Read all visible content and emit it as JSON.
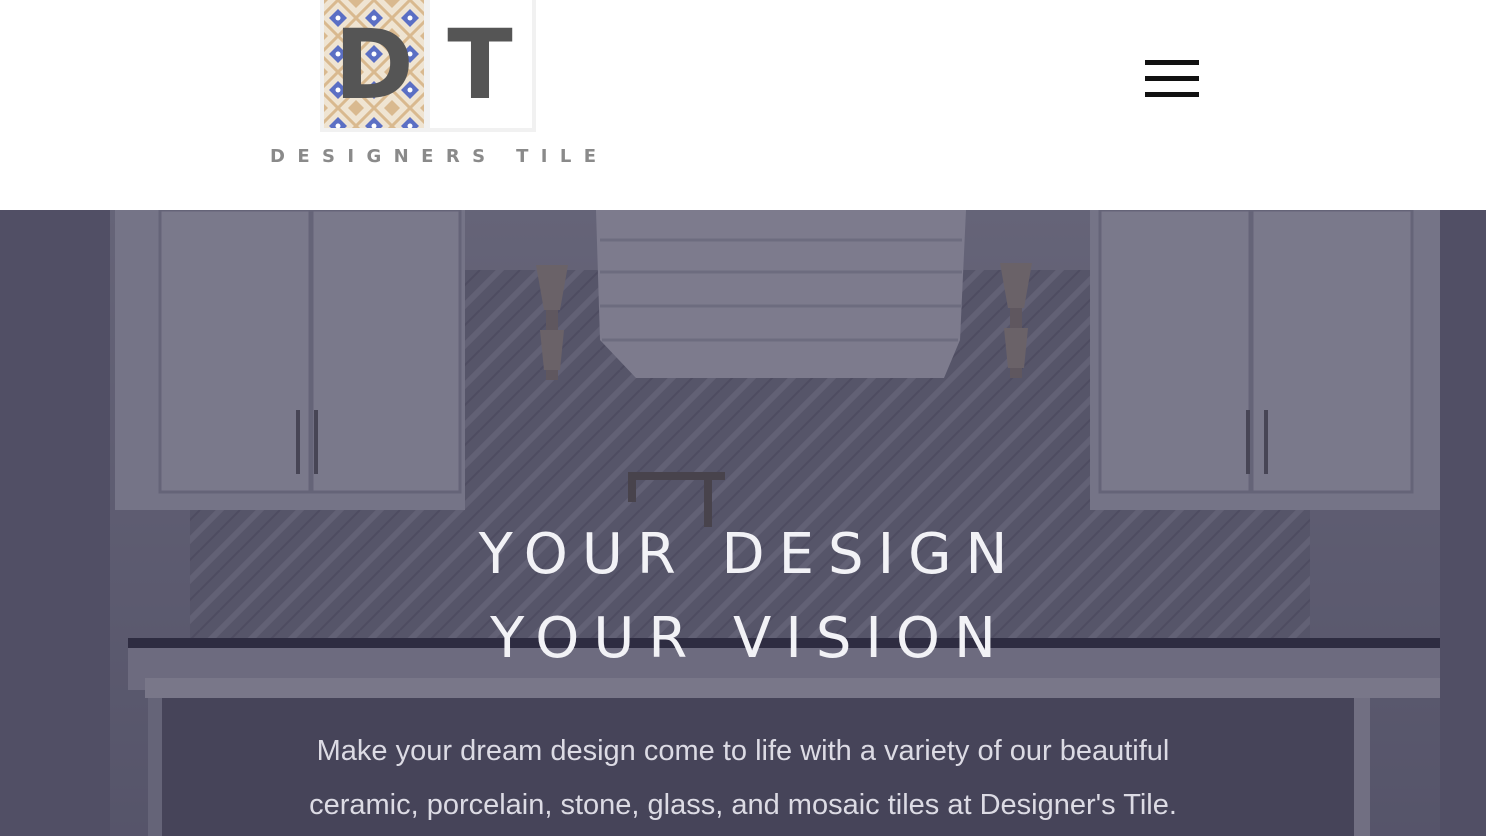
{
  "header": {
    "logo": {
      "letters": [
        "D",
        "T"
      ],
      "wordmark": "DESIGNERS TILE"
    },
    "menu_icon": "hamburger-menu-icon"
  },
  "hero": {
    "title_lines": [
      "YOUR DESIGN",
      "YOUR VISION"
    ],
    "description": "Make your dream design come to life with a variety of our beautiful ceramic, porcelain, stone, glass, and mosaic tiles at Designer's Tile."
  },
  "colors": {
    "logo_tile_blue": "#5b6fc4",
    "logo_tile_tan": "#d9b98f",
    "logo_letter_grey": "#555555",
    "hero_overlay": "#22203a",
    "hero_text": "#f2f2f6"
  }
}
